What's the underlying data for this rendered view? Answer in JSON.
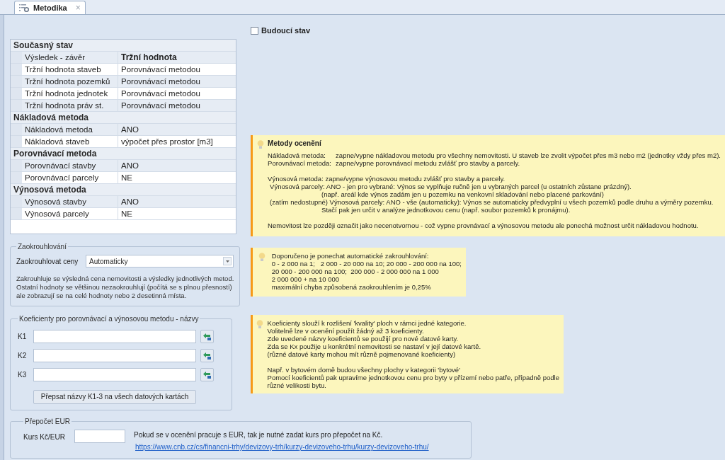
{
  "tab": {
    "label": "Metodika",
    "selected": true,
    "close": "×"
  },
  "future_state": {
    "label": "Budoucí stav",
    "checked": false
  },
  "property_grid": [
    {
      "category": "Současný stav",
      "rows": [
        {
          "kind": "header",
          "name": "Výsledek - závěr",
          "value": "Tržní hodnota"
        },
        {
          "kind": "value",
          "name": "Tržní hodnota staveb",
          "value": "Porovnávací metodou"
        },
        {
          "kind": "value",
          "name": "Tržní hodnota pozemků",
          "value": "Porovnávací metodou"
        },
        {
          "kind": "value",
          "name": "Tržní hodnota jednotek",
          "value": "Porovnávací metodou"
        },
        {
          "kind": "value",
          "name": "Tržní hodnota práv st.",
          "value": "Porovnávací metodou"
        }
      ]
    },
    {
      "category": "Nákladová metoda",
      "rows": [
        {
          "kind": "value",
          "name": "Nákladová metoda",
          "value": "ANO"
        },
        {
          "kind": "value",
          "name": "Nákladová staveb",
          "value": "výpočet přes prostor [m3]"
        }
      ]
    },
    {
      "category": "Porovnávací metoda",
      "rows": [
        {
          "kind": "value",
          "name": "Porovnávací stavby",
          "value": "ANO"
        },
        {
          "kind": "value",
          "name": "Porovnávací parcely",
          "value": "NE"
        }
      ]
    },
    {
      "category": "Výnosová metoda",
      "rows": [
        {
          "kind": "value",
          "name": "Výnosová stavby",
          "value": "ANO"
        },
        {
          "kind": "value",
          "name": "Výnosová parcely",
          "value": "NE"
        }
      ]
    }
  ],
  "rounding": {
    "title": "Zaokrouhlování",
    "label": "Zaokrouhlovat ceny",
    "value": "Automaticky",
    "note": "Zakrouhluje se výsledná cena nemovitosti a výsledky jednotlivých metod.\nOstatní hodnoty se většinou nezaokrouhlují (počítá se s plnou přesností)\nale zobrazují se na celé hodnoty nebo 2 desetinná místa."
  },
  "coefficients": {
    "title": "Koeficienty pro porovnávací a výnosovou metodu - názvy",
    "fields": [
      {
        "label": "K1"
      },
      {
        "label": "K2"
      },
      {
        "label": "K3"
      }
    ],
    "button": "Přepsat názvy K1-3 na všech datových kartách"
  },
  "eur": {
    "title": "Přepočet EUR",
    "label": "Kurs Kč/EUR",
    "note": "Pokud se v ocenění pracuje s EUR, tak je nutné zadat kurs pro přepočet na Kč.",
    "link": "https://www.cnb.cz/cs/financni-trhy/devizovy-trh/kurzy-devizoveho-trhu/kurzy-devizoveho-trhu/"
  },
  "tips": [
    {
      "title": "Metody ocenění",
      "lines": [
        {
          "kind": "term",
          "term": "Nákladová metoda:",
          "text": "zapne/vypne nákladovou metodu pro všechny nemovitosti. U staveb lze zvolit výpočet přes m3 nebo m2 (jednotky vždy přes m2)."
        },
        {
          "kind": "term",
          "term": "Porovnávací metoda:",
          "text": "zapne/vypne porovnávací metodu zvlášť pro stavby a parcely."
        },
        {
          "kind": "gap"
        },
        {
          "kind": "plain",
          "text": "Výnosová metoda: zapne/vypne výnosovou metodu zvlášť pro stavby a parcely."
        },
        {
          "kind": "sub",
          "text": "Výnosová parcely: ANO - jen pro vybrané: Výnos se vyplňuje ručně jen u vybraných parcel (u ostatních zůstane prázdný)."
        },
        {
          "kind": "continuation",
          "text": "(např. areál kde výnos zadám jen u pozemku na venkovní skladování nebo placené parkování)"
        },
        {
          "kind": "sub",
          "text": "(zatím nedostupné) Výnosová parcely: ANO - vše (automaticky): Výnos se automaticky předvyplní u všech pozemků podle druhu a výměry pozemku."
        },
        {
          "kind": "continuation",
          "text": "Stačí pak jen určit v analýze jednotkovou cenu (např. soubor pozemků k pronájmu)."
        },
        {
          "kind": "gap"
        },
        {
          "kind": "plain",
          "text": "Nemovitost lze později označit jako necenotvornou - což vypne provnávací a výnosovou metodu ale ponechá možnost určit nákladovou hodnotu."
        }
      ]
    },
    {
      "lines": [
        {
          "kind": "plain",
          "text": "Doporučeno je ponechat automatické zakrouhlování:"
        },
        {
          "kind": "plain",
          "text": "0 - 2 000 na 1;   2 000 - 20 000 na 10; 20 000 - 200 000 na 100;"
        },
        {
          "kind": "plain",
          "text": "20 000 - 200 000 na 100;  200 000 - 2 000 000 na 1 000"
        },
        {
          "kind": "plain",
          "text": "2 000 000 + na 10 000"
        },
        {
          "kind": "plain",
          "text": "maximální chyba způsobená zaokrouhlením je 0,25%"
        }
      ]
    },
    {
      "lines": [
        {
          "kind": "plain",
          "text": "Koeficienty slouží k rozlišení 'kvality' ploch v rámci jedné kategorie."
        },
        {
          "kind": "plain",
          "text": "Volitelně lze v ocenění použít žádný až 3 koeficienty."
        },
        {
          "kind": "plain",
          "text": "Zde uvedené názvy koeficientů se použijí pro nové datové karty."
        },
        {
          "kind": "plain",
          "text": "Zda se Kx použije u konkrétní nemovitosti se nastaví v její datové kartě."
        },
        {
          "kind": "plain",
          "text": "(různé datové karty mohou mít různě pojmenované koeficienty)"
        },
        {
          "kind": "gap"
        },
        {
          "kind": "plain",
          "text": "Např. v bytovém domě budou všechny plochy v kategorii 'bytové'"
        },
        {
          "kind": "plain",
          "text": "Pomocí koeficientů pak upravíme jednotkovou cenu pro byty v přízemí nebo patře, případně podle"
        },
        {
          "kind": "plain",
          "text": "různé velikosti bytu."
        }
      ]
    }
  ]
}
